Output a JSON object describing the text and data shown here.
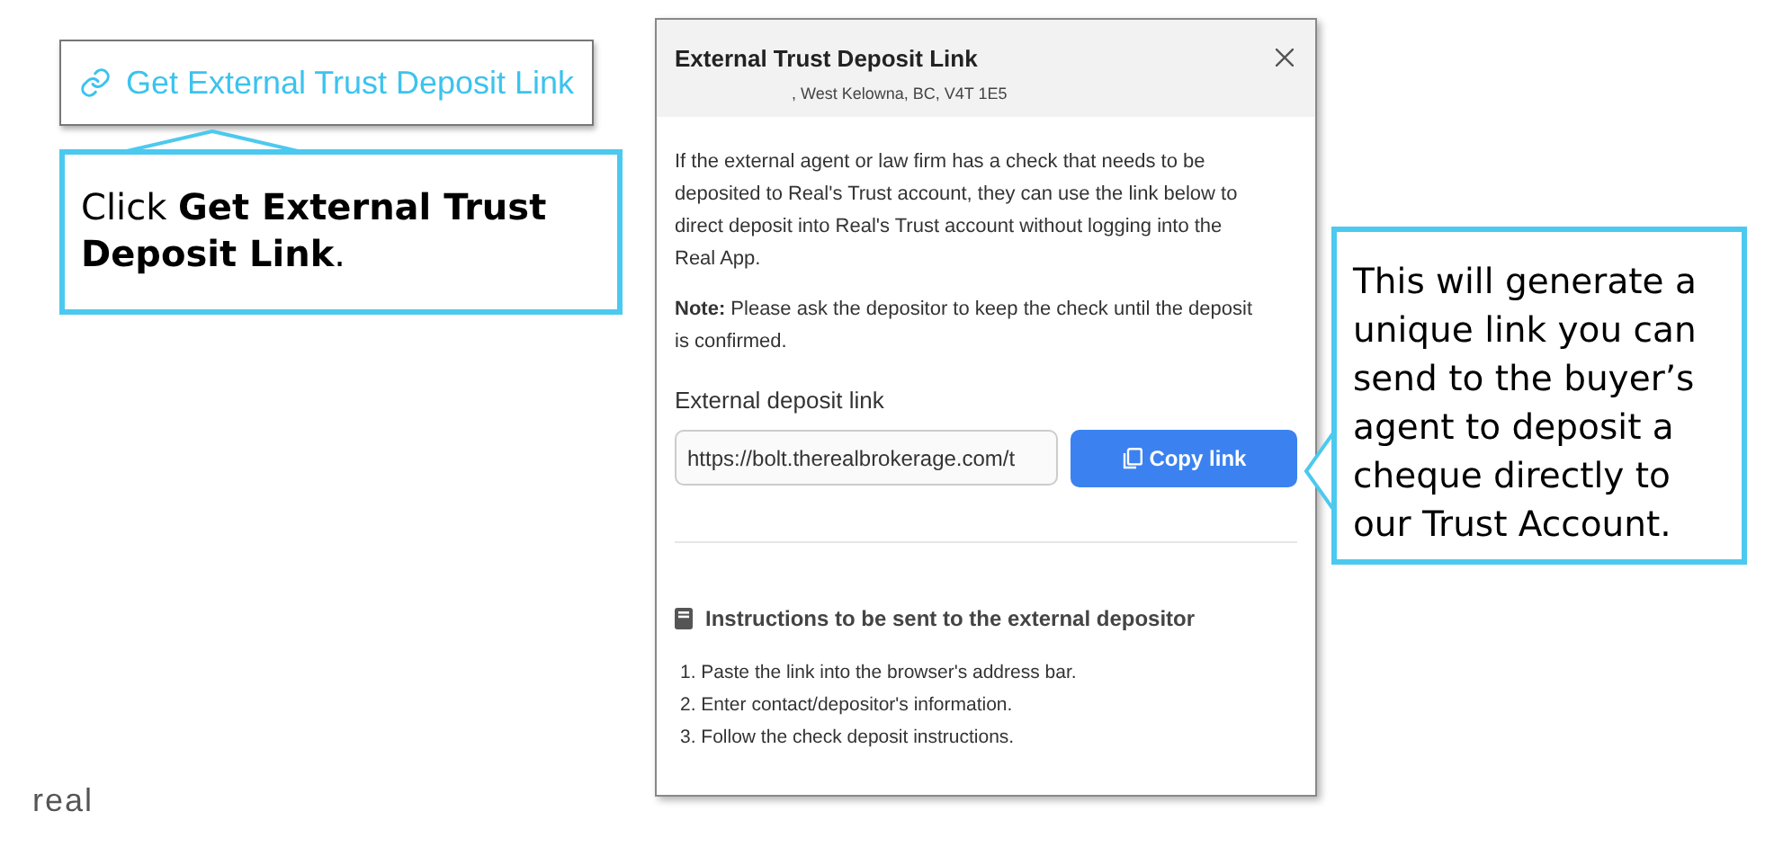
{
  "trigger_button": {
    "label": "Get External Trust Deposit Link"
  },
  "callouts": [
    {
      "text": "Click **Get External Trust Deposit Link**."
    },
    {
      "text": "This will generate a unique link you can send to the buyer’s agent to deposit a cheque directly to our Trust Account."
    }
  ],
  "modal": {
    "title": "External Trust Deposit Link",
    "subtitle": ", West Kelowna, BC, V4T 1E5",
    "description": "If the external agent or law firm has a check that needs to be deposited to Real's Trust account, they can use the link below to direct deposit into Real's Trust account without logging into the Real App.",
    "note": "**Note:** Please ask the depositor to keep the check until the deposit is confirmed.",
    "link_label": "External deposit link",
    "link_value": "https://bolt.therealbrokerage.com/t",
    "copy_button": "Copy link",
    "instructions_title": "Instructions to be sent to the external depositor",
    "instructions": [
      "1. Paste the link into the browser's address bar.",
      "2. Enter contact/depositor's information.",
      "3. Follow the check deposit instructions."
    ]
  },
  "logo": "real"
}
